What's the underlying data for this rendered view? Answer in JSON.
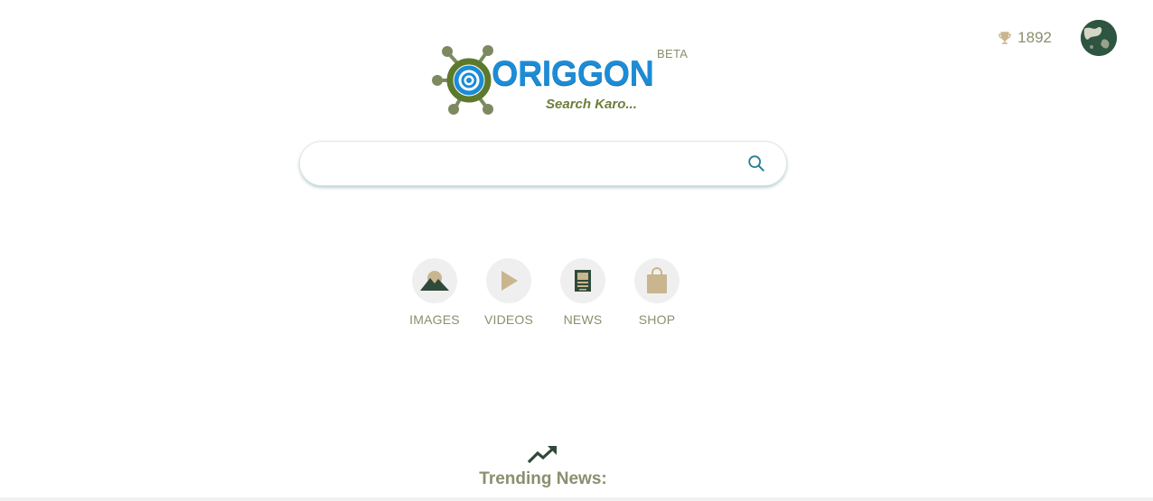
{
  "header": {
    "points_value": "1892",
    "points_icon": "trophy-icon",
    "avatar_icon": "user-avatar"
  },
  "logo": {
    "title": "ORIGGON",
    "tagline": "Search Karo...",
    "badge": "BETA",
    "brand_color": "#1c8cd6",
    "accent_color": "#6e7e3c"
  },
  "search": {
    "placeholder": "",
    "value": "",
    "button_icon": "search-icon",
    "icon_color": "#2a7f95"
  },
  "categories": [
    {
      "label": "IMAGES",
      "icon": "mountain-image-icon"
    },
    {
      "label": "VIDEOS",
      "icon": "play-icon"
    },
    {
      "label": "NEWS",
      "icon": "newspaper-icon"
    },
    {
      "label": "SHOP",
      "icon": "shopping-bag-icon"
    }
  ],
  "trending": {
    "title": "Trending News:",
    "icon": "trending-up-icon"
  },
  "colors": {
    "muted_text": "#8a8f6e",
    "dark_green": "#2f4a3a",
    "tan": "#c9b58e"
  }
}
